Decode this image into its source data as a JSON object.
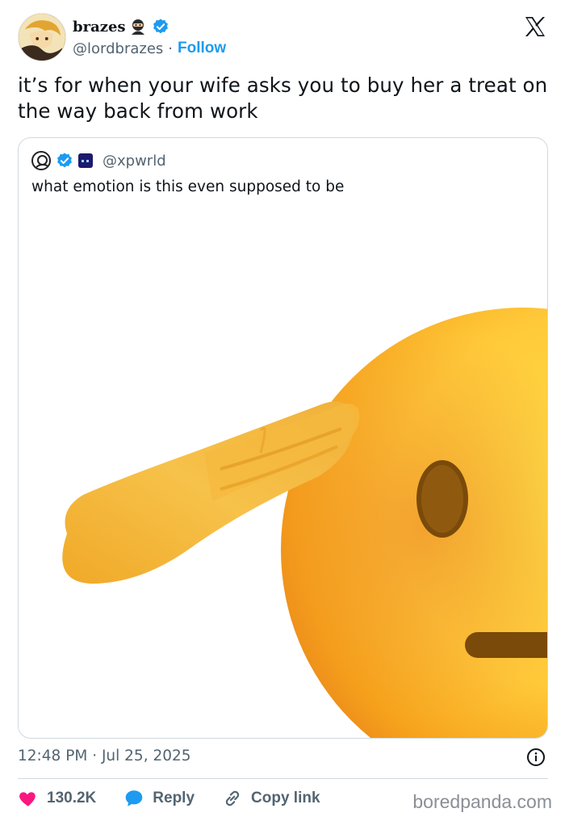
{
  "author": {
    "display_name": "brazes",
    "handle": "@lordbrazes",
    "separator": "·",
    "follow_label": "Follow",
    "icons": [
      "ninja-emoji-icon",
      "verified-icon"
    ]
  },
  "tweet": {
    "text": "it’s for when your wife asks you to buy her a treat on the way back from work"
  },
  "quote": {
    "handle": "@xpwrld",
    "text": "what emotion is this even supposed to be",
    "image": "saluting-face-emoji"
  },
  "meta": {
    "timestamp": "12:48 PM · Jul 25, 2025"
  },
  "actions": {
    "like_count": "130.2K",
    "reply_label": "Reply",
    "copy_link_label": "Copy link"
  },
  "watermark": "boredpanda.com",
  "colors": {
    "accent": "#1d9bf0",
    "like": "#f91880",
    "muted": "#536471",
    "border": "#cfd9de"
  }
}
